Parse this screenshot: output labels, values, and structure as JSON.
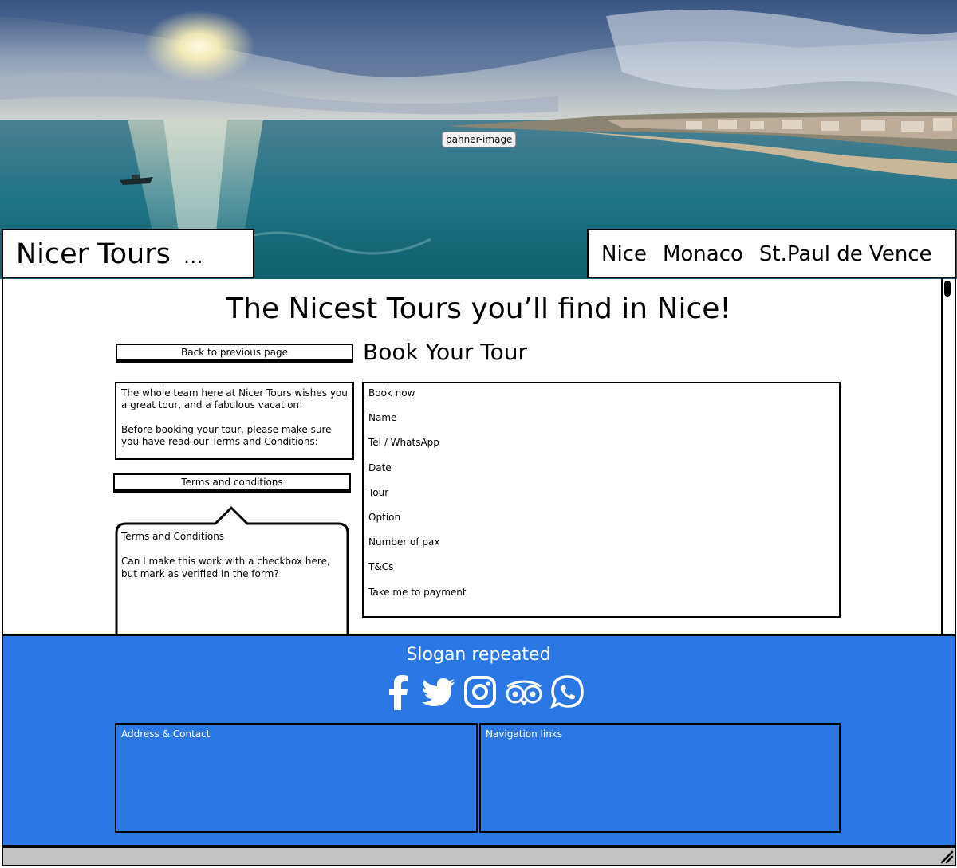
{
  "banner": {
    "label": "banner-image"
  },
  "header": {
    "logo": "Nicer Tours",
    "logo_suffix": "...",
    "nav": [
      "Nice",
      "Monaco",
      "St.Paul de Vence"
    ]
  },
  "main": {
    "headline": "The Nicest Tours you’ll find in Nice!",
    "back_button": "Back to previous page",
    "intro": [
      "The whole team here at Nicer Tours wishes you a great tour, and a fabulous vacation!",
      "Before booking your tour, please make sure you have read our Terms and Conditions:"
    ],
    "terms_button": "Terms and conditions",
    "callout": {
      "title": "Terms and Conditions",
      "body": "Can I make this work with a checkbox here, but mark as verified in the form?"
    },
    "book_title": "Book Your Tour",
    "form_fields": [
      "Book now",
      "Name",
      "Tel / WhatsApp",
      "Date",
      "Tour",
      "Option",
      "Number of pax",
      "T&Cs",
      "Take me to payment"
    ]
  },
  "footer": {
    "slogan": "Slogan repeated",
    "socials": [
      "facebook-icon",
      "twitter-icon",
      "instagram-icon",
      "tripadvisor-icon",
      "whatsapp-icon"
    ],
    "address_label": "Address & Contact",
    "navigation_label": "Navigation links",
    "color": "#2b78e4"
  }
}
